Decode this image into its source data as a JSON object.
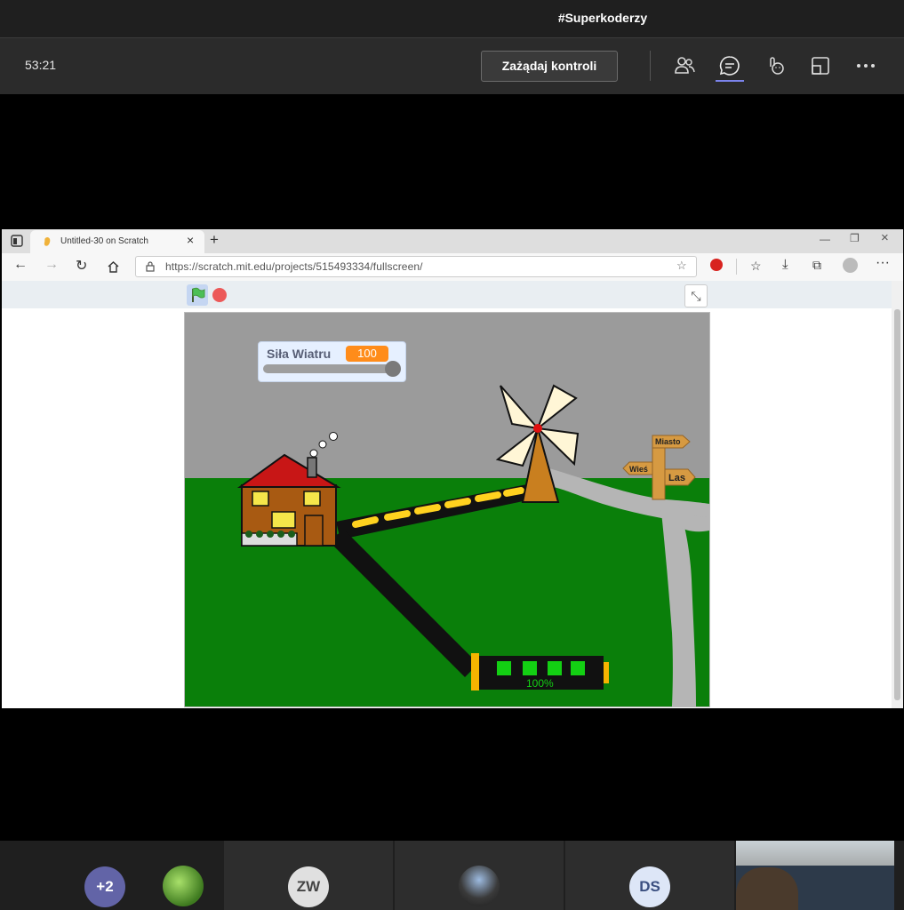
{
  "meeting": {
    "title": "#Superkoderzy",
    "timer": "53:21",
    "request_control_label": "Zażądaj kontroli"
  },
  "toolbar_icons": [
    "people-icon",
    "chat-icon",
    "reactions-icon",
    "share-tray-icon",
    "more-icon"
  ],
  "browser": {
    "tab_title": "Untitled-30 on Scratch",
    "url": "https://scratch.mit.edu/projects/515493334/fullscreen/"
  },
  "scratch": {
    "slider": {
      "label": "Siła Wiatru",
      "value": "100",
      "level_percent": 100
    },
    "battery": {
      "label": "100%",
      "level_percent": 100
    },
    "signpost": {
      "miasto": "Miasto",
      "wies": "Wieś",
      "las": "Las"
    }
  },
  "participants": [
    {
      "type": "more",
      "label": "+2",
      "color": "#6264a7"
    },
    {
      "type": "photo",
      "label": ""
    },
    {
      "type": "initials",
      "label": "ZW",
      "color": "#e0e0e0"
    },
    {
      "type": "photo",
      "label": ""
    },
    {
      "type": "initials",
      "label": "DS",
      "color": "#dde6f7"
    },
    {
      "type": "video",
      "label": ""
    }
  ]
}
